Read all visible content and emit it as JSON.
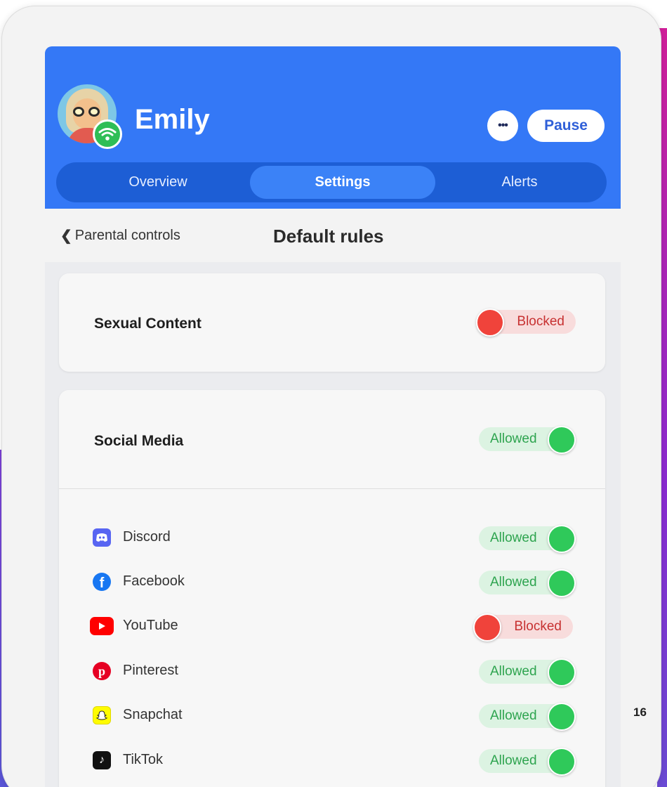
{
  "profile": {
    "name": "Emily"
  },
  "header": {
    "more_label": "•••",
    "pause_label": "Pause"
  },
  "tabs": [
    {
      "label": "Overview",
      "active": false
    },
    {
      "label": "Settings",
      "active": true
    },
    {
      "label": "Alerts",
      "active": false
    }
  ],
  "subheader": {
    "back_label": "Parental controls",
    "title": "Default rules"
  },
  "categories": [
    {
      "title": "Sexual Content",
      "status": "Blocked"
    },
    {
      "title": "Social Media",
      "status": "Allowed"
    }
  ],
  "apps": [
    {
      "name": "Discord",
      "icon": "discord-icon",
      "status": "Allowed"
    },
    {
      "name": "Facebook",
      "icon": "facebook-icon",
      "status": "Allowed"
    },
    {
      "name": "YouTube",
      "icon": "youtube-icon",
      "status": "Blocked"
    },
    {
      "name": "Pinterest",
      "icon": "pinterest-icon",
      "status": "Allowed"
    },
    {
      "name": "Snapchat",
      "icon": "snapchat-icon",
      "status": "Allowed"
    },
    {
      "name": "TikTok",
      "icon": "tiktok-icon",
      "status": "Allowed"
    }
  ],
  "colors": {
    "brand_blue": "#3478f6",
    "tab_bar": "#1d5ed5",
    "allowed_green": "#2fc95a",
    "blocked_red": "#f0433b"
  },
  "page_number": "16"
}
